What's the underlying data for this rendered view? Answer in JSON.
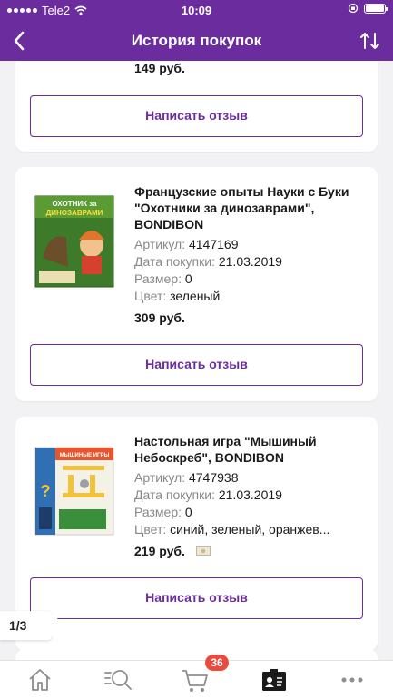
{
  "status_bar": {
    "carrier": "Tele2",
    "time": "10:09"
  },
  "header": {
    "title": "История покупок"
  },
  "review_label": "Написать отзыв",
  "orders": [
    {
      "price": "149 руб."
    },
    {
      "name": "Французские опыты Науки с Буки \"Охотники за динозаврами\", BONDIBON",
      "article_label": "Артикул:",
      "article": "4147169",
      "date_label": "Дата покупки:",
      "date": "21.03.2019",
      "size_label": "Размер:",
      "size": "0",
      "color_label": "Цвет:",
      "color": "зеленый",
      "price": "309 руб.",
      "box_text": "ОХОТНИК за ДИНОЗАВРАМИ"
    },
    {
      "name": "Настольная игра \"Мышиный Небоскреб\", BONDIBON",
      "article_label": "Артикул:",
      "article": "4747938",
      "date_label": "Дата покупки:",
      "date": "21.03.2019",
      "size_label": "Размер:",
      "size": "0",
      "color_label": "Цвет:",
      "color": "синий, зеленый, оранжев...",
      "price": "219 руб.",
      "box_text": "МЫШИНЫЕ ИГРЫ"
    }
  ],
  "pager": "1/3",
  "tabbar": {
    "items": [
      "home-icon",
      "search-icon",
      "cart-icon",
      "profile-card-icon",
      "more-icon"
    ],
    "cart_badge": "36",
    "accent": "#6b2d9e"
  }
}
